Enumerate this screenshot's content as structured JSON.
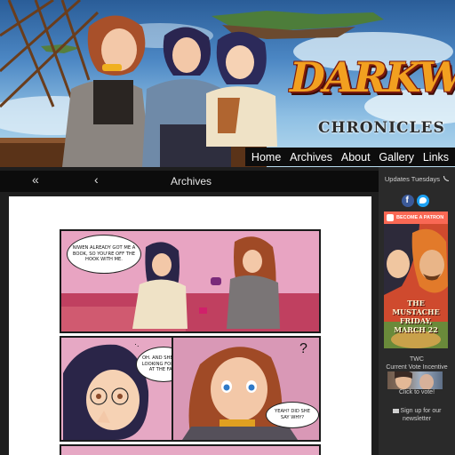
{
  "banner": {
    "logo_main": "DARKWYND",
    "logo_sub": "CHRONICLES"
  },
  "topnav": [
    {
      "label": "Home",
      "name": "nav-home"
    },
    {
      "label": "Archives",
      "name": "nav-archives"
    },
    {
      "label": "About",
      "name": "nav-about"
    },
    {
      "label": "Gallery",
      "name": "nav-gallery"
    },
    {
      "label": "Links",
      "name": "nav-links"
    }
  ],
  "comic_nav": {
    "first_icon": "«",
    "prev_icon": "‹",
    "title": "Archives"
  },
  "comic": {
    "panel1_text": "NIWEN ALREADY GOT ME A BOOK, SO YOU'RE OFF THE HOOK WITH ME.",
    "panel2_text": "OH. AND SHE WAS LOOKING FOR YOU AT THE FAIR.",
    "panel2_dots": "·.",
    "panel3_text": "YEAH? DID SHE SAY WHY?",
    "panel3_question": "?"
  },
  "sidebar": {
    "updates": "Updates Tuesdays",
    "patron_label": "BECOME A PATRON",
    "promo_text": "THE MUSTACHE FRIDAY, MARCH 22",
    "twc_label": "TWC",
    "vote_label": "Current Vote Incentive",
    "click_label": "Click to vote!",
    "signup_label": "Sign up for our newsletter"
  },
  "colors": {
    "patreon": "#f96854",
    "facebook": "#3b5998",
    "twitter": "#1da1f2"
  }
}
